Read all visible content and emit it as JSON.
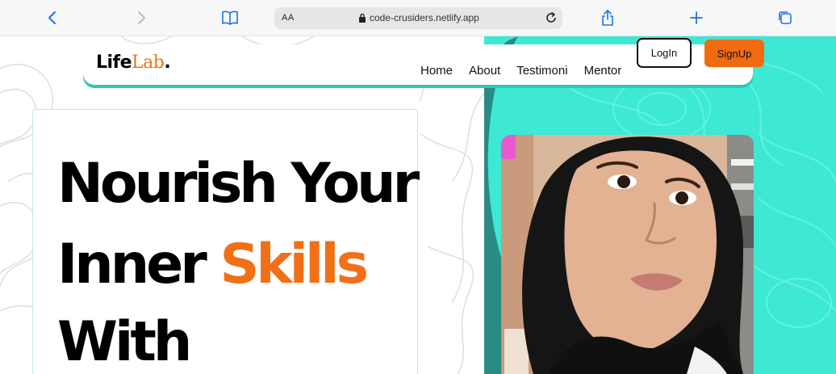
{
  "browser": {
    "aa_label": "AA",
    "url": "code-crusiders.netlify.app"
  },
  "navbar": {
    "logo_part1": "Life",
    "logo_part2": "Lab",
    "logo_dot": ".",
    "links": [
      "Home",
      "About",
      "Testimoni",
      "Mentor"
    ],
    "login_label": "LogIn",
    "signup_label": "SignUp"
  },
  "hero": {
    "line1": "Nourish Your",
    "line2_plain": "Inner ",
    "line2_accent": "Skills",
    "line3": "With"
  },
  "colors": {
    "accent_orange": "#f07018",
    "teal": "#3de8d4",
    "teal_dark": "#2a8a84",
    "signup_bg": "#f06b10"
  },
  "icons": [
    "chevron-left-icon",
    "chevron-right-icon",
    "book-icon",
    "lock-icon",
    "reload-icon",
    "share-icon",
    "plus-icon",
    "tabs-icon"
  ]
}
